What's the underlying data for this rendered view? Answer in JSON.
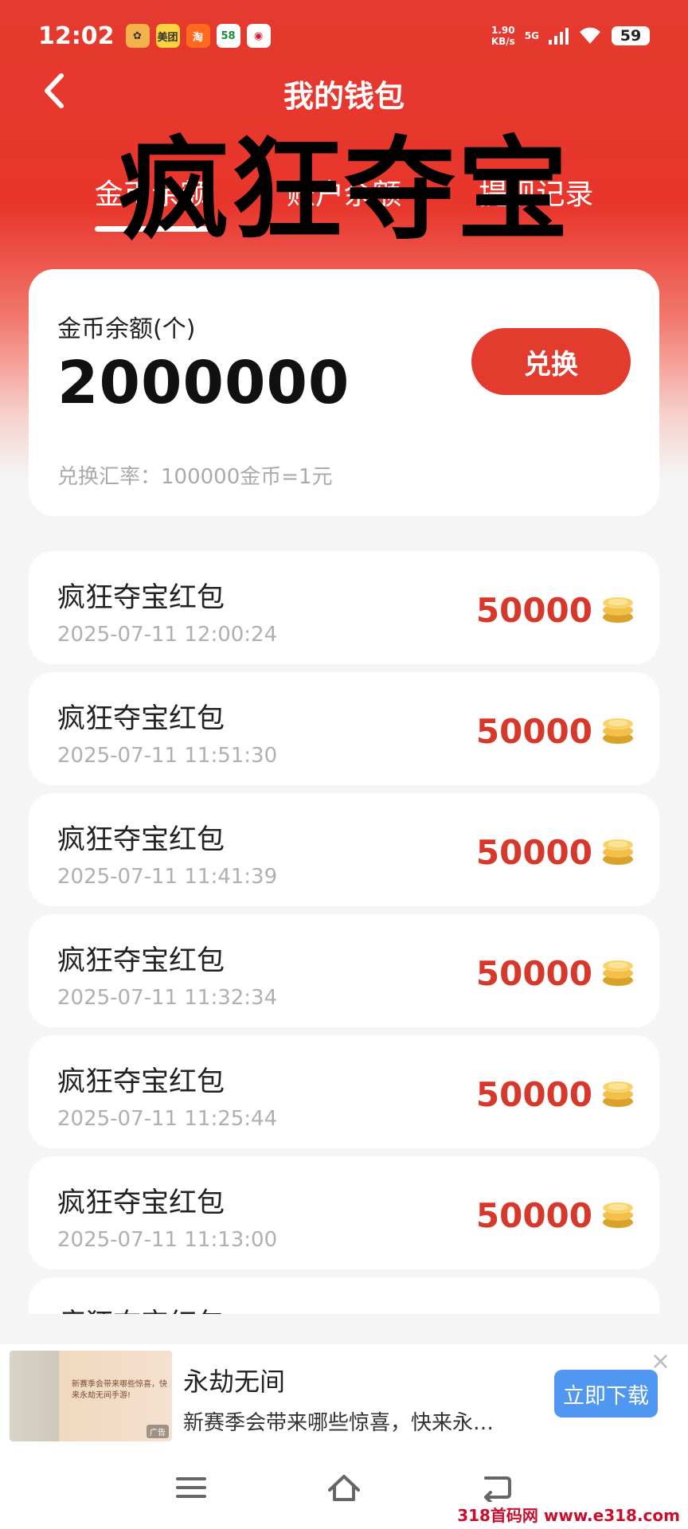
{
  "status_bar": {
    "time": "12:02",
    "apps": [
      {
        "name": "app-icon",
        "label": "",
        "color": "#f6b24a"
      },
      {
        "name": "meituan-icon",
        "label": "美团",
        "color": "#ffd23f"
      },
      {
        "name": "taobao-icon",
        "label": "淘",
        "color": "#ff6a1f"
      },
      {
        "name": "58-icon",
        "label": "58",
        "color": "#ffffff"
      },
      {
        "name": "weibo-icon",
        "label": "",
        "color": "#ffffff"
      }
    ],
    "speed_value": "1.90",
    "speed_unit": "KB/s",
    "network": "5G",
    "battery": "59"
  },
  "nav": {
    "title": "我的钱包"
  },
  "tabs": [
    {
      "label": "金币余额",
      "active": true
    },
    {
      "label": "账户余额",
      "active": false
    },
    {
      "label": "提现记录",
      "active": false
    }
  ],
  "watermark_text": "疯狂夺宝",
  "balance": {
    "label": "金币余额(个)",
    "value": "2000000",
    "exchange_button": "兑换",
    "rate": "兑换汇率：100000金币=1元"
  },
  "records": [
    {
      "title": "疯狂夺宝红包",
      "time": "2025-07-11 12:00:24",
      "amount": "50000"
    },
    {
      "title": "疯狂夺宝红包",
      "time": "2025-07-11 11:51:30",
      "amount": "50000"
    },
    {
      "title": "疯狂夺宝红包",
      "time": "2025-07-11 11:41:39",
      "amount": "50000"
    },
    {
      "title": "疯狂夺宝红包",
      "time": "2025-07-11 11:32:34",
      "amount": "50000"
    },
    {
      "title": "疯狂夺宝红包",
      "time": "2025-07-11 11:25:44",
      "amount": "50000"
    },
    {
      "title": "疯狂夺宝红包",
      "time": "2025-07-11 11:13:00",
      "amount": "50000"
    },
    {
      "title": "疯狂夺宝红包",
      "time": "",
      "amount": ""
    }
  ],
  "ad": {
    "title": "永劫无间",
    "description": "新赛季会带来哪些惊喜，快来永…",
    "thumb_text": "新赛季会带来哪些惊喜，快来永劫无间手游!",
    "thumb_tag": "广告",
    "download_button": "立即下载",
    "close": "×"
  },
  "site_watermark": "318首码网 www.e318.com",
  "colors": {
    "primary_red": "#e33b2e",
    "amount_red": "#d6382c",
    "download_blue": "#4f97f1"
  }
}
